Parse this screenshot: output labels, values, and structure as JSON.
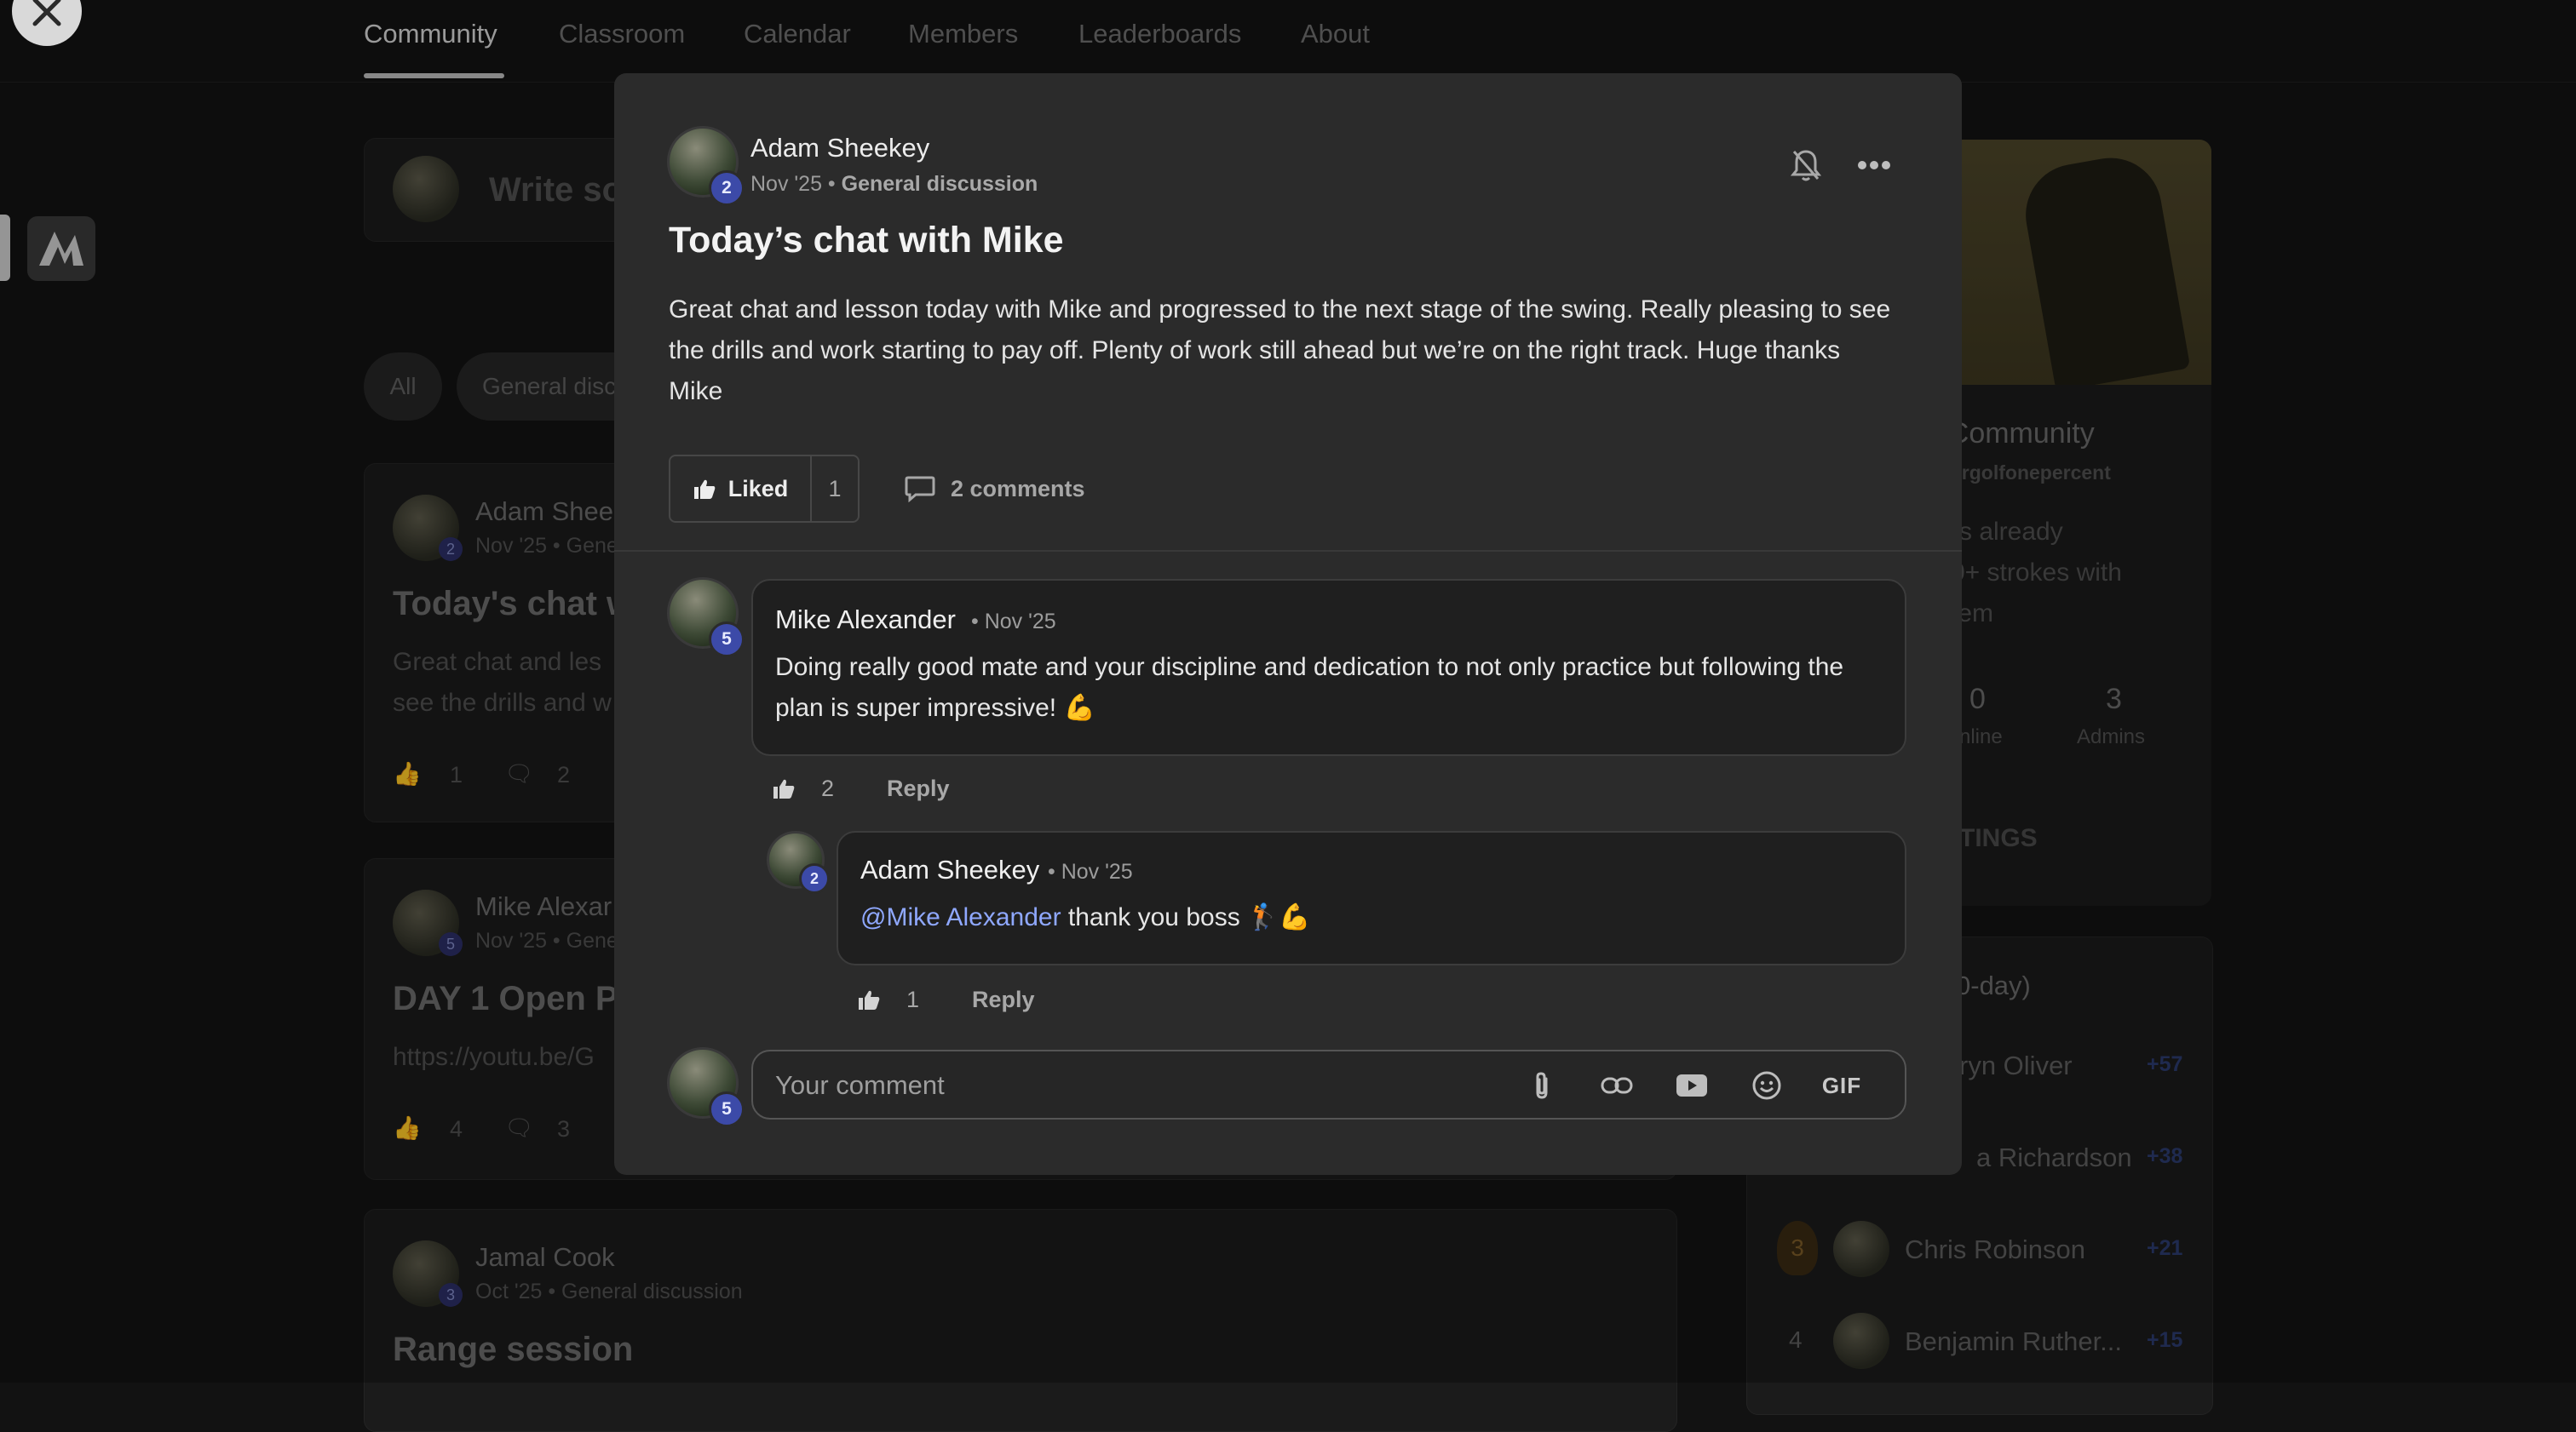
{
  "nav": {
    "tabs": [
      "Community",
      "Classroom",
      "Calendar",
      "Members",
      "Leaderboards",
      "About"
    ]
  },
  "background": {
    "composer_placeholder": "Write so",
    "filters": [
      "All",
      "General disc"
    ],
    "feed": [
      {
        "author": "Adam Shee",
        "meta": "Nov '25 • Gene",
        "title": "Today's chat w",
        "text1": "Great chat and les",
        "text2": "see the drills and w",
        "likes": "1",
        "comments": "2",
        "badge": "2"
      },
      {
        "author": "Mike Alexar",
        "meta": "Nov '25 • Gene",
        "title": "DAY 1 Open Pr",
        "text1": "https://youtu.be/G",
        "text2": "",
        "likes": "4",
        "comments": "3",
        "badge": "5"
      },
      {
        "author": "Jamal Cook",
        "meta": "Oct '25 • General discussion",
        "title": "Range session",
        "text1": "",
        "text2": "",
        "likes": "",
        "comments": "",
        "badge": "3"
      }
    ],
    "side": {
      "community_name": "r Community",
      "handle": "ergolfonepercent",
      "desc": [
        "rs already",
        "0+ strokes with",
        "tem"
      ],
      "stats": [
        {
          "value": "0",
          "label": "nline"
        },
        {
          "value": "3",
          "label": "Admins"
        }
      ],
      "settings_label": "TINGS",
      "leaderboard_title": "0-day)",
      "leaders": [
        {
          "rank": "",
          "name": "ryn Oliver",
          "points": "+57"
        },
        {
          "rank": "",
          "name": "a Richardson",
          "points": "+38"
        },
        {
          "rank": "3",
          "name": "Chris Robinson",
          "points": "+21"
        },
        {
          "rank": "4",
          "name": "Benjamin Ruther...",
          "points": "+15"
        }
      ]
    }
  },
  "post": {
    "author": "Adam Sheekey",
    "author_level": "2",
    "date": "Nov '25",
    "category": "General discussion",
    "title": "Today’s chat with Mike",
    "body": "Great chat and lesson today with Mike and progressed to the next stage of the swing. Really pleasing to see the drills and work starting to pay off. Plenty of work still ahead but we’re on the right track. Huge thanks Mike",
    "liked_label": "Liked",
    "like_count": "1",
    "comments_label": "2 comments"
  },
  "comments": [
    {
      "author": "Mike Alexander",
      "level": "5",
      "date": "• Nov '25",
      "text": "Doing really good mate and your discipline and dedication to not only practice but following the plan is super impressive! 💪",
      "likes": "2",
      "reply_label": "Reply"
    },
    {
      "author": "Adam Sheekey",
      "level": "2",
      "date": "• Nov '25",
      "mention": "@Mike Alexander",
      "text": " thank you boss 🏌️💪",
      "likes": "1",
      "reply_label": "Reply"
    }
  ],
  "composer": {
    "avatar_level": "5",
    "placeholder": "Your comment",
    "gif_label": "GIF"
  }
}
